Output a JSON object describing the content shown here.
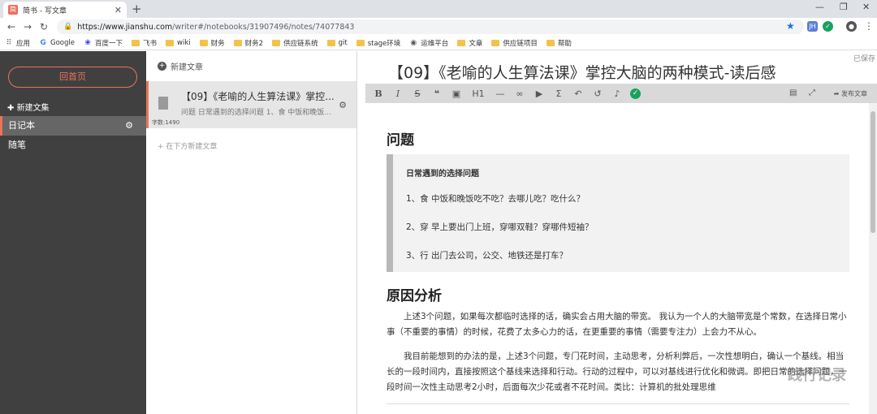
{
  "browser": {
    "tab_title": "简书 - 写文章",
    "url_host": "https://www.jianshu.com",
    "url_path": "/writer#/notebooks/31907496/notes/74077843",
    "bookmarks": [
      "应用",
      "Google",
      "百度一下",
      "飞书",
      "wiki",
      "财务",
      "财务2",
      "供应链系统",
      "git",
      "stage环境",
      "运维平台",
      "文章",
      "供应链项目",
      "帮助"
    ]
  },
  "sidebar": {
    "home_label": "回首页",
    "new_notebook": "新建文集",
    "notebooks": [
      "日记本",
      "随笔"
    ]
  },
  "notelist": {
    "new_article": "新建文章",
    "note_title": "【09】《老喻的人生算法课》掌控...",
    "note_abstract": "问题 日常遇到的选择问题 1、食 中饭和晚饭...",
    "word_count": "字数:1490",
    "new_below": "在下方新建文章"
  },
  "editor": {
    "saved": "已保存",
    "title": "【09】《老喻的人生算法课》掌控大脑的两种模式-读后感",
    "publish": "发布文章",
    "h_problem": "问题",
    "quote_head": "日常遇到的选择问题",
    "q1": "1、食  中饭和晚饭吃不吃？去哪儿吃？吃什么？",
    "q2": "2、穿  早上要出门上班，穿哪双鞋？穿哪件短袖？",
    "q3": "3、行  出门去公司，公交、地铁还是打车？",
    "h_reason": "原因分析",
    "p1": "上述3个问题，如果每次都临时选择的话，确实会占用大脑的带宽。 我认为一个人的大脑带宽是个常数，在选择日常小事（不重要的事情）的时候，花费了太多心力的话，在更重要的事情（需要专注力）上会力不从心。",
    "p2": "我目前能想到的办法的是，上述3个问题，专门花时间，主动思考，分析利弊后，一次性想明白，确认一个基线。相当长的一段时间内，直接按照这个基线来选择和行动。行动的过程中，可以对基线进行优化和微调。即把日常的选择问题，一段时间一次性主动思考2小时，后面每次少花或者不花时间。类比：计算机的批处理思维",
    "watermark": "践行记录"
  }
}
